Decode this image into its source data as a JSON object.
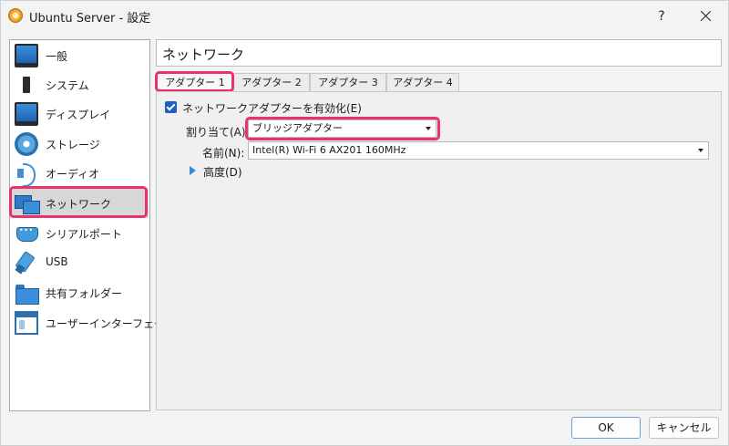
{
  "window": {
    "title": "Ubuntu Server - 設定",
    "help_label": "?",
    "close_label": "close"
  },
  "sidebar": {
    "items": [
      {
        "label": "一般",
        "icon": "monitor-icon"
      },
      {
        "label": "システム",
        "icon": "chip-icon"
      },
      {
        "label": "ディスプレイ",
        "icon": "display-icon"
      },
      {
        "label": "ストレージ",
        "icon": "disk-icon"
      },
      {
        "label": "オーディオ",
        "icon": "speaker-icon"
      },
      {
        "label": "ネットワーク",
        "icon": "network-icon",
        "selected": true
      },
      {
        "label": "シリアルポート",
        "icon": "serial-port-icon"
      },
      {
        "label": "USB",
        "icon": "usb-icon"
      },
      {
        "label": "共有フォルダー",
        "icon": "folder-icon"
      },
      {
        "label": "ユーザーインターフェース",
        "icon": "ui-window-icon"
      }
    ]
  },
  "main": {
    "page_title": "ネットワーク",
    "tabs": [
      {
        "label": "アダプター 1",
        "active": true
      },
      {
        "label": "アダプター 2"
      },
      {
        "label": "アダプター 3"
      },
      {
        "label": "アダプター 4"
      }
    ],
    "enable_adapter": {
      "label": "ネットワークアダプターを有効化(E)",
      "checked": true
    },
    "attached_to": {
      "label": "割り当て(A):",
      "value": "ブリッジアダプター"
    },
    "name": {
      "label": "名前(N):",
      "value": "Intel(R) Wi-Fi 6 AX201 160MHz"
    },
    "advanced": {
      "label": "高度(D)",
      "expanded": false
    }
  },
  "footer": {
    "ok_label": "OK",
    "cancel_label": "キャンセル"
  },
  "colors": {
    "highlight": "#e8336b",
    "checkbox_accent": "#1f5fbf",
    "selection_bg": "#d7d7d7"
  }
}
